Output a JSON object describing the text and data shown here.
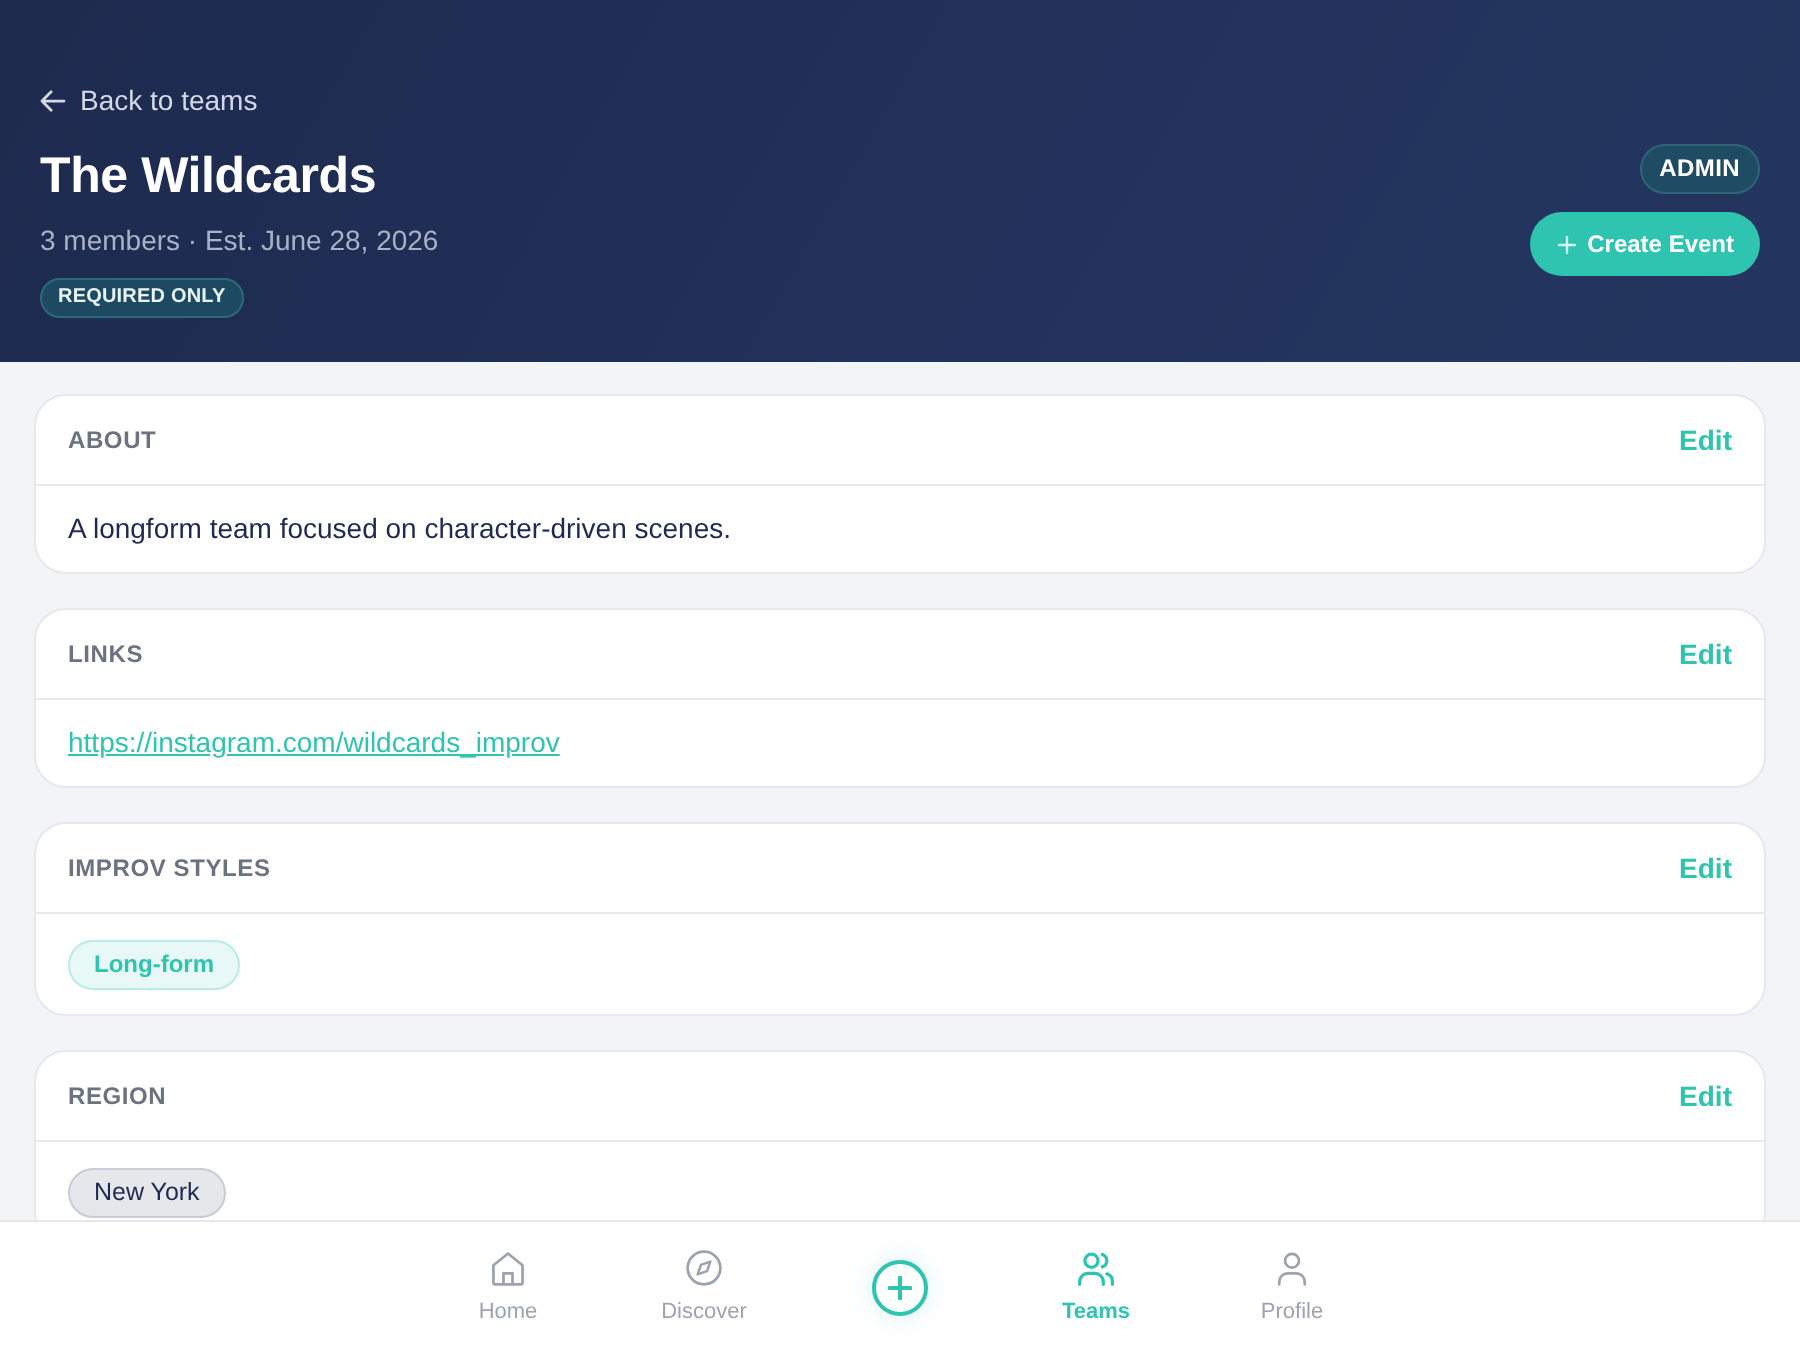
{
  "header": {
    "back_link": "Back to teams",
    "title": "The Wildcards",
    "subtitle": "3 members · Est. June 28, 2026",
    "badges": [
      {
        "label": "REQUIRED ONLY"
      }
    ],
    "role_badge": "ADMIN",
    "create_button": "Create Event"
  },
  "sections": [
    {
      "title": "ABOUT",
      "action": "Edit",
      "kind": "text",
      "text": "A longform team focused on character-driven scenes."
    },
    {
      "title": "LINKS",
      "action": "Edit",
      "kind": "links",
      "links": [
        "https://instagram.com/wildcards_improv"
      ]
    },
    {
      "title": "IMPROV STYLES",
      "action": "Edit",
      "kind": "accent-chips",
      "chips": [
        "Long-form"
      ]
    },
    {
      "title": "REGION",
      "action": "Edit",
      "kind": "neutral-chips",
      "chips": [
        "New York"
      ]
    }
  ],
  "bottom_nav": {
    "tabs": [
      {
        "label": "Home",
        "selected": false
      },
      {
        "label": "Discover",
        "selected": false
      },
      {
        "label": "Teams",
        "selected": true
      },
      {
        "label": "Profile",
        "selected": false
      }
    ]
  }
}
